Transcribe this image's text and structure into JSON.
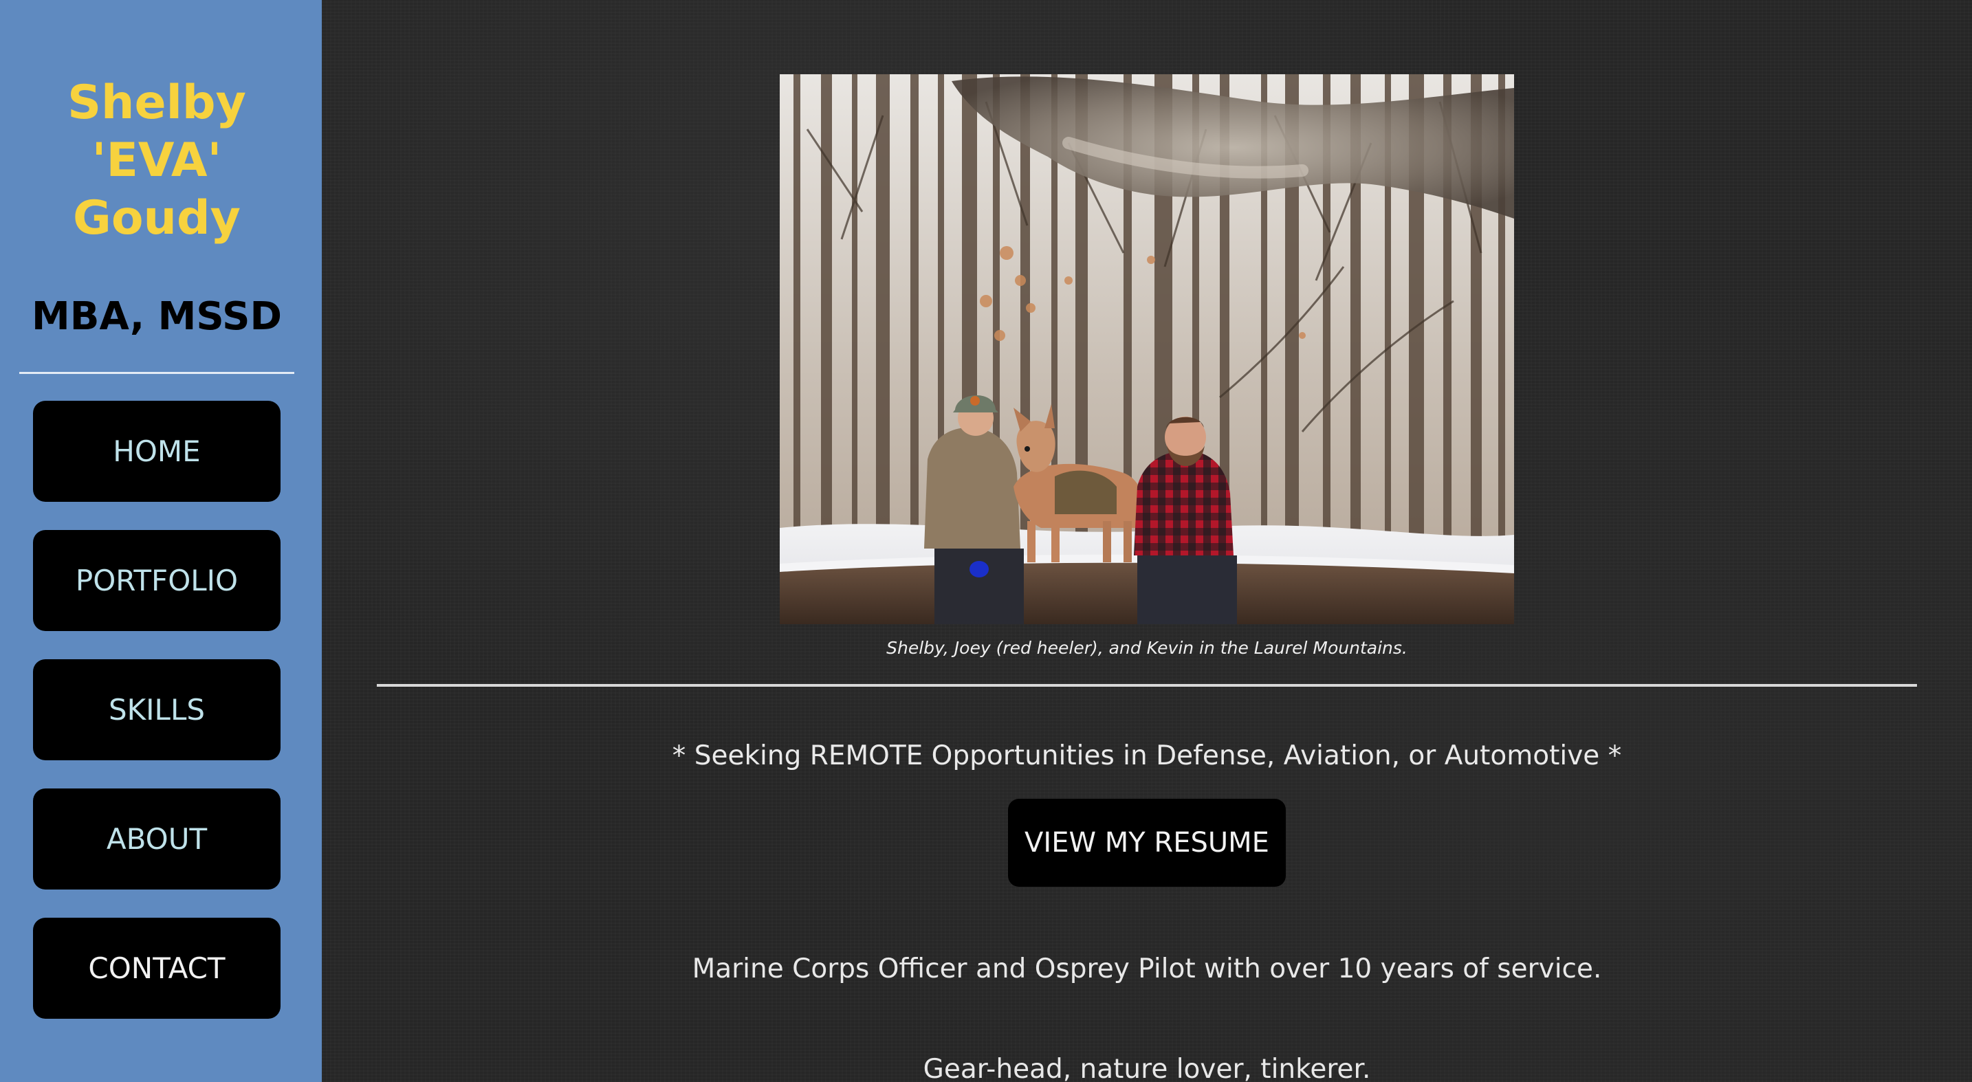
{
  "sidebar": {
    "name_lines": [
      "Shelby",
      "'EVA'",
      "Goudy"
    ],
    "degrees": "MBA, MSSD",
    "nav": [
      {
        "label": "HOME"
      },
      {
        "label": "PORTFOLIO"
      },
      {
        "label": "SKILLS"
      },
      {
        "label": "ABOUT"
      },
      {
        "label": "CONTACT"
      }
    ]
  },
  "main": {
    "photo_caption": "Shelby, Joey (red heeler), and Kevin in the Laurel Mountains.",
    "seeking": "* Seeking REMOTE Opportunities in Defense, Aviation, or Automotive *",
    "resume_button": "VIEW MY RESUME",
    "intro": "Marine Corps Officer and Osprey Pilot with over 10 years of service.",
    "tagline": "Gear-head, nature lover, tinkerer."
  },
  "colors": {
    "sidebar_bg": "#5f8ac0",
    "name_yellow": "#f7d23e",
    "nav_text": "#bfe2ea",
    "page_bg": "#262626",
    "button_bg": "#000000"
  }
}
